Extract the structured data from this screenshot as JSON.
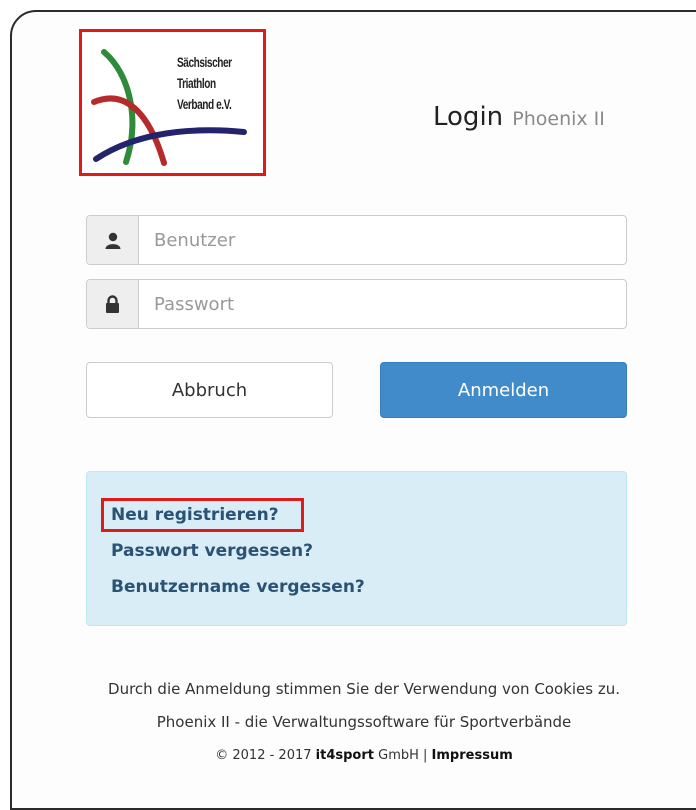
{
  "logo": {
    "lines": [
      "Sächsischer",
      "Triathlon",
      "Verband e.V."
    ],
    "colors": {
      "green": "#2e8b3a",
      "red": "#b52a2a",
      "blue": "#23246b"
    }
  },
  "header": {
    "title": "Login",
    "subtitle": "Phoenix II"
  },
  "form": {
    "username_placeholder": "Benutzer",
    "password_placeholder": "Passwort",
    "user_icon": "user-icon",
    "lock_icon": "lock-icon"
  },
  "buttons": {
    "cancel": "Abbruch",
    "login": "Anmelden"
  },
  "links": {
    "register": "Neu registrieren?",
    "forgot_password": "Passwort vergessen?",
    "forgot_username": "Benutzername vergessen?"
  },
  "footer": {
    "cookies": "Durch die Anmeldung stimmen Sie der Verwendung von Cookies zu.",
    "tagline": "Phoenix II - die Verwaltungssoftware für Sportverbände",
    "copyright": "© 2012 - 2017",
    "brand": "it4sport",
    "company_suffix": "GmbH |",
    "impressum": "Impressum"
  },
  "colors": {
    "primary": "#428bca",
    "info_bg": "#d9edf7",
    "highlight": "#e0191b"
  }
}
